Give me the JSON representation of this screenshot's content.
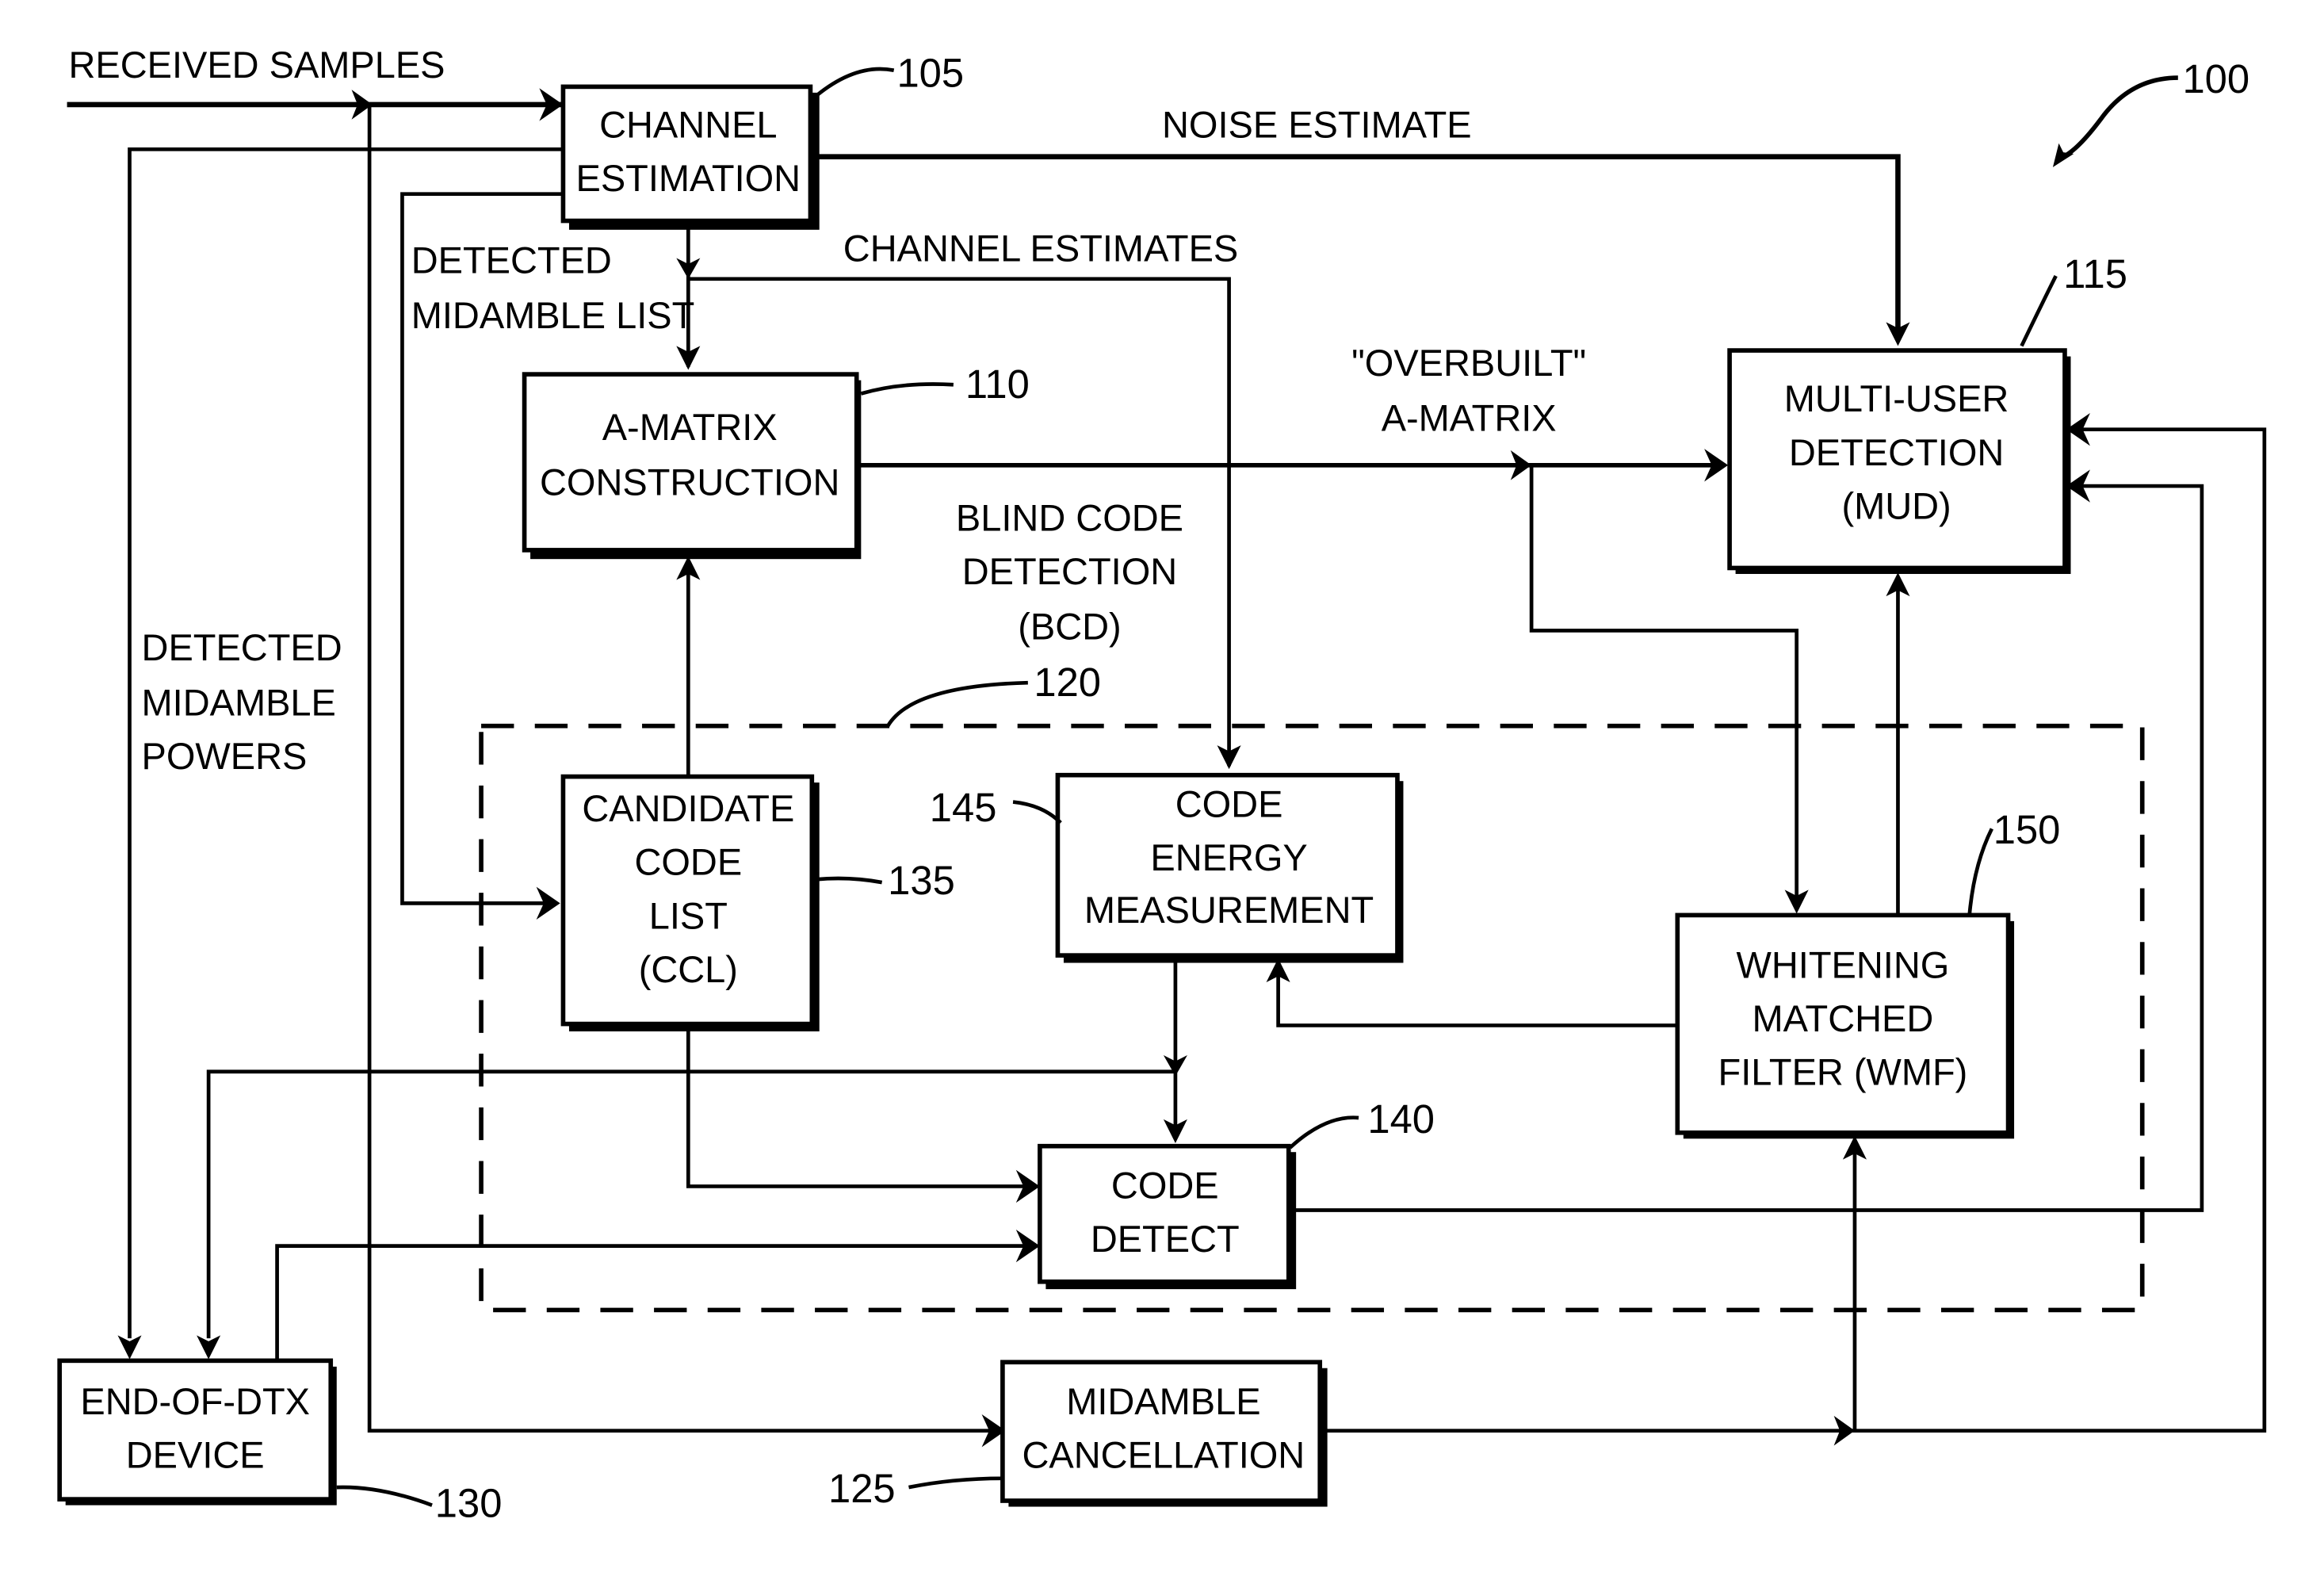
{
  "figure_number": "100",
  "blocks": {
    "channel_estimation": {
      "lines": [
        "CHANNEL",
        "ESTIMATION"
      ],
      "ref": "105"
    },
    "a_matrix": {
      "lines": [
        "A-MATRIX",
        "CONSTRUCTION"
      ],
      "ref": "110"
    },
    "mud": {
      "lines": [
        "MULTI-USER",
        "DETECTION",
        "(MUD)"
      ],
      "ref": "115"
    },
    "ccl": {
      "lines": [
        "CANDIDATE",
        "CODE",
        "LIST",
        "(CCL)"
      ],
      "ref": "135"
    },
    "code_energy": {
      "lines": [
        "CODE",
        "ENERGY",
        "MEASUREMENT"
      ],
      "ref": "145"
    },
    "wmf": {
      "lines": [
        "WHITENING",
        "MATCHED",
        "FILTER (WMF)"
      ],
      "ref": "150"
    },
    "code_detect": {
      "lines": [
        "CODE",
        "DETECT"
      ],
      "ref": "140"
    },
    "end_of_dtx": {
      "lines": [
        "END-OF-DTX",
        "DEVICE"
      ],
      "ref": "130"
    },
    "midamble_cancel": {
      "lines": [
        "MIDAMBLE",
        "CANCELLATION"
      ],
      "ref": "125"
    }
  },
  "bcd_group": {
    "lines": [
      "BLIND CODE",
      "DETECTION",
      "(BCD)"
    ],
    "ref": "120"
  },
  "signals": {
    "received_samples": "RECEIVED SAMPLES",
    "noise_estimate": "NOISE ESTIMATE",
    "channel_estimates": "CHANNEL ESTIMATES",
    "detected_midamble_list": [
      "DETECTED",
      "MIDAMBLE LIST"
    ],
    "overbuilt_a_matrix": [
      "\"OVERBUILT\"",
      "A-MATRIX"
    ],
    "detected_midamble_powers": [
      "DETECTED",
      "MIDAMBLE",
      "POWERS"
    ]
  }
}
